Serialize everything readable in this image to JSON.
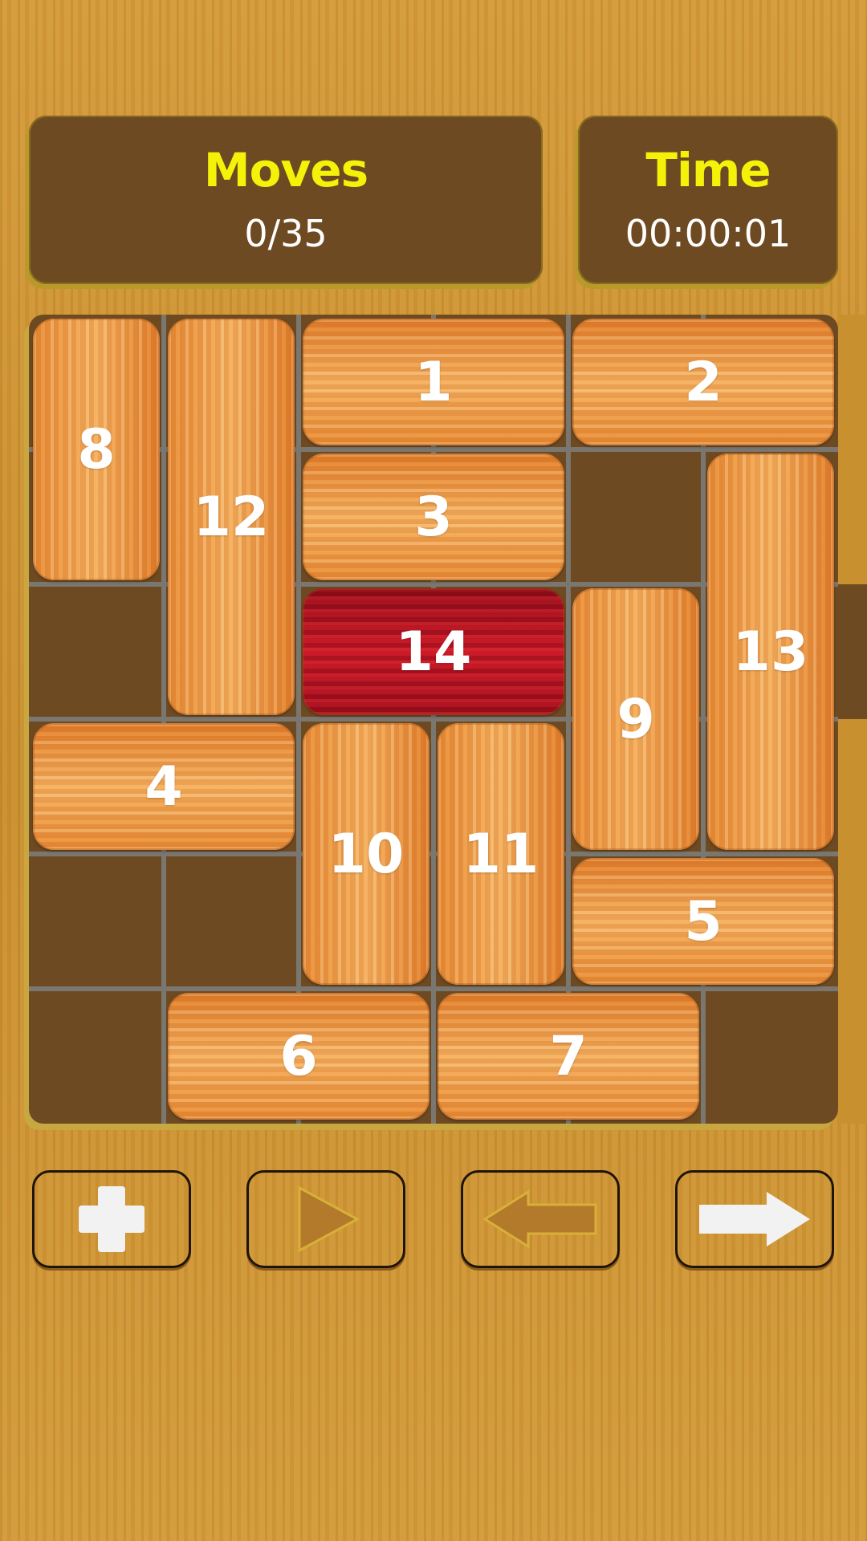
{
  "moves": {
    "label": "Moves",
    "value": "0/35"
  },
  "time": {
    "label": "Time",
    "value": "00:00:01"
  },
  "board": {
    "cols": 6,
    "rows": 6,
    "exit_side": "right",
    "exit_row": 2,
    "blocks": [
      {
        "label": "8",
        "col": 0,
        "row": 0,
        "w": 1,
        "h": 2,
        "target": false
      },
      {
        "label": "12",
        "col": 1,
        "row": 0,
        "w": 1,
        "h": 3,
        "target": false
      },
      {
        "label": "1",
        "col": 2,
        "row": 0,
        "w": 2,
        "h": 1,
        "target": false
      },
      {
        "label": "2",
        "col": 4,
        "row": 0,
        "w": 2,
        "h": 1,
        "target": false
      },
      {
        "label": "3",
        "col": 2,
        "row": 1,
        "w": 2,
        "h": 1,
        "target": false
      },
      {
        "label": "13",
        "col": 5,
        "row": 1,
        "w": 1,
        "h": 3,
        "target": false
      },
      {
        "label": "14",
        "col": 2,
        "row": 2,
        "w": 2,
        "h": 1,
        "target": true
      },
      {
        "label": "9",
        "col": 4,
        "row": 2,
        "w": 1,
        "h": 2,
        "target": false
      },
      {
        "label": "4",
        "col": 0,
        "row": 3,
        "w": 2,
        "h": 1,
        "target": false
      },
      {
        "label": "10",
        "col": 2,
        "row": 3,
        "w": 1,
        "h": 2,
        "target": false
      },
      {
        "label": "11",
        "col": 3,
        "row": 3,
        "w": 1,
        "h": 2,
        "target": false
      },
      {
        "label": "5",
        "col": 4,
        "row": 4,
        "w": 2,
        "h": 1,
        "target": false
      },
      {
        "label": "6",
        "col": 1,
        "row": 5,
        "w": 2,
        "h": 1,
        "target": false
      },
      {
        "label": "7",
        "col": 3,
        "row": 5,
        "w": 2,
        "h": 1,
        "target": false
      }
    ]
  },
  "controls": [
    {
      "name": "new-game-button",
      "icon": "plus-icon",
      "enabled": true
    },
    {
      "name": "play-button",
      "icon": "play-icon",
      "enabled": false
    },
    {
      "name": "undo-button",
      "icon": "arrow-left-icon",
      "enabled": false
    },
    {
      "name": "redo-button",
      "icon": "arrow-right-icon",
      "enabled": true
    }
  ],
  "colors": {
    "panel": "#6e4a22",
    "title": "#f5f20a",
    "block": "#f0a048",
    "target_block": "#b8141f",
    "grid_line": "#7a7670",
    "icon_active": "#f2f2f2",
    "icon_disabled": "#b27a2a"
  }
}
